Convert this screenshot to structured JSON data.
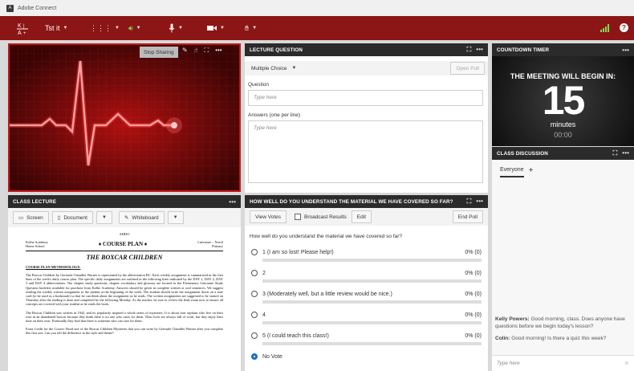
{
  "window": {
    "title": "Adobe Connect"
  },
  "toolbar": {
    "meeting_name": "Tst it"
  },
  "share_pod": {
    "stop_sharing": "Stop Sharing"
  },
  "question_pod": {
    "title": "LECTURE QUESTION",
    "type": "Multiple Choice",
    "open_poll": "Open Poll",
    "question_label": "Question",
    "question_placeholder": "Type here",
    "answers_label": "Answers (one per line)",
    "answers_placeholder": "Type here"
  },
  "timer_pod": {
    "title": "COUNTDOWN TIMER",
    "message": "THE MEETING WILL BEGIN IN:",
    "number": "15",
    "unit": "minutes",
    "time": "00:00"
  },
  "discussion_pod": {
    "title": "CLASS DISCUSSION",
    "tab": "Everyone",
    "add": "+",
    "messages": [
      {
        "name": "Kelly Powers:",
        "text": "Good morning, class. Does anyone have questions before we begin today's lesson?"
      },
      {
        "name": "Colin:",
        "text": "Good morning! Is there a quiz this week?"
      }
    ],
    "placeholder": "Type here"
  },
  "lecture_pod": {
    "title": "CLASS LECTURE",
    "buttons": [
      "Screen",
      "Document",
      "Whiteboard"
    ],
    "doc": {
      "header": "AHDO",
      "left_top": "Kolbe Academy",
      "left_bottom": "Home School",
      "plan": "COURSE PLAN",
      "right_top": "Literature – Novel",
      "right_bottom": "Primary",
      "book": "THE BOXCAR CHILDREN",
      "section": "COURSE PLAN METHODOLOGY:",
      "p1": "The Boxcar Children by Gertrude Chandler Warner is represented by the abbreviation BC. Each weekly assignment is summarized in the first lines of the week's daily course plan. The specific daily assignments are outlined in the following lines indicated by the DAY 1, DAY 2, DAY 3 and DAY 4 abbreviations. The chapter study questions, chapter vocabulary and glossary are located in the Elementary Literature Study Question booklets available for purchase from Kolbe Academy. Answers should be given in complete written or oral sentences. We suggest reading the weekly written assignment to the student at the beginning of the week. The student should write the assignment down on a note card (to be used as a bookmark) so that he can think about the assignment as he reads. The written assignments are suggested to be started on Thursday after the reading is done and completed by the following Monday. As the teacher, be sure to review the final exam now to ensure all concepts are covered with your student as he reads the book.",
      "p2": "The Boxcar Children was written in 1942, and its popularity inspired a whole series of mysteries. It is about four orphans who live on their own in an abandoned boxcar because they think there is no one who cares for them. Their lives are always full of work, but they enjoy their time on their own. Eventually they find that there is someone who can care for them.",
      "p3": "Extra Credit for the Course: Read one of the Boxcar Children Mysteries that you can write by Gertrude Chandler Warner after you complete this first one. Can you tell the difference in the style and theme?"
    }
  },
  "poll_pod": {
    "title": "HOW WELL DO YOU UNDERSTAND THE MATERIAL WE HAVE COVERED SO FAR?",
    "view_votes": "View Votes",
    "broadcast": "Broadcast Results",
    "edit": "Edit",
    "end_poll": "End Poll",
    "question": "How well do you understand the material we have covered so far?",
    "options": [
      {
        "label": "1 (I am so lost! Please help!)",
        "result": "0% (0)"
      },
      {
        "label": "2",
        "result": "0% (0)"
      },
      {
        "label": "3 (Moderately well, but a little review would be nice.)",
        "result": "0% (0)"
      },
      {
        "label": "4",
        "result": "0% (0)"
      },
      {
        "label": "5 (I could teach this class!)",
        "result": "0% (0)"
      }
    ],
    "no_vote": "No Vote"
  }
}
